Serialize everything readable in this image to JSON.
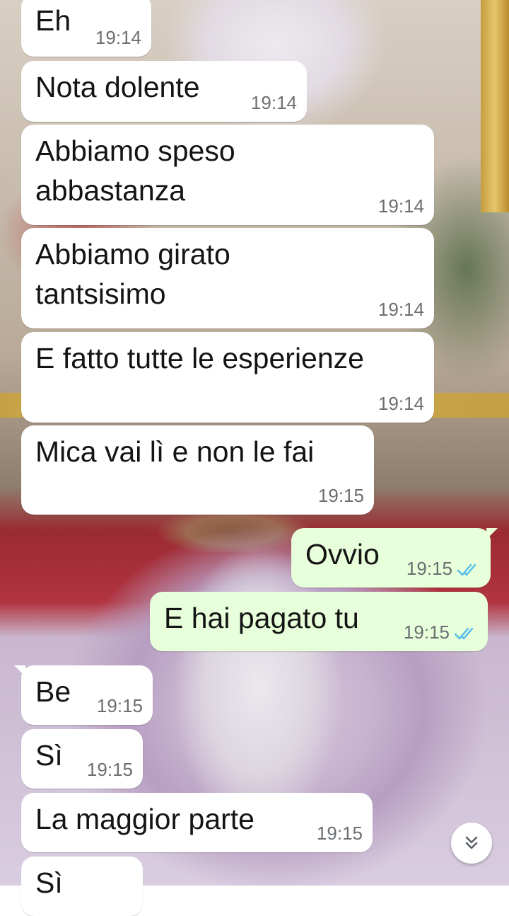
{
  "messages": [
    {
      "direction": "incoming",
      "lines": [
        "Eh"
      ],
      "time": "19:14"
    },
    {
      "direction": "incoming",
      "lines": [
        "Nota dolente"
      ],
      "time": "19:14"
    },
    {
      "direction": "incoming",
      "lines": [
        "Abbiamo speso",
        "abbastanza"
      ],
      "time": "19:14"
    },
    {
      "direction": "incoming",
      "lines": [
        "Abbiamo girato",
        "tantsisimo"
      ],
      "time": "19:14"
    },
    {
      "direction": "incoming",
      "lines": [
        "E fatto tutte le esperienze"
      ],
      "time": "19:14"
    },
    {
      "direction": "incoming",
      "lines": [
        "Mica vai lì e non le fai"
      ],
      "time": "19:15"
    },
    {
      "direction": "outgoing",
      "lines": [
        "Ovvio"
      ],
      "time": "19:15",
      "status": "read"
    },
    {
      "direction": "outgoing",
      "lines": [
        "E hai pagato tu"
      ],
      "time": "19:15",
      "status": "read"
    },
    {
      "direction": "incoming",
      "lines": [
        "Be"
      ],
      "time": "19:15"
    },
    {
      "direction": "incoming",
      "lines": [
        "Sì"
      ],
      "time": "19:15"
    },
    {
      "direction": "incoming",
      "lines": [
        "La maggior parte"
      ],
      "time": "19:15"
    },
    {
      "direction": "incoming",
      "lines": [
        "Sì"
      ],
      "time": ""
    }
  ],
  "colors": {
    "incoming_bubble": "#ffffff",
    "outgoing_bubble": "#e7ffdb",
    "read_ticks": "#53bdeb",
    "timestamp": "#6b6f72"
  },
  "icons": {
    "read_status": "double-check-icon",
    "scroll_down": "double-chevron-down-icon"
  }
}
